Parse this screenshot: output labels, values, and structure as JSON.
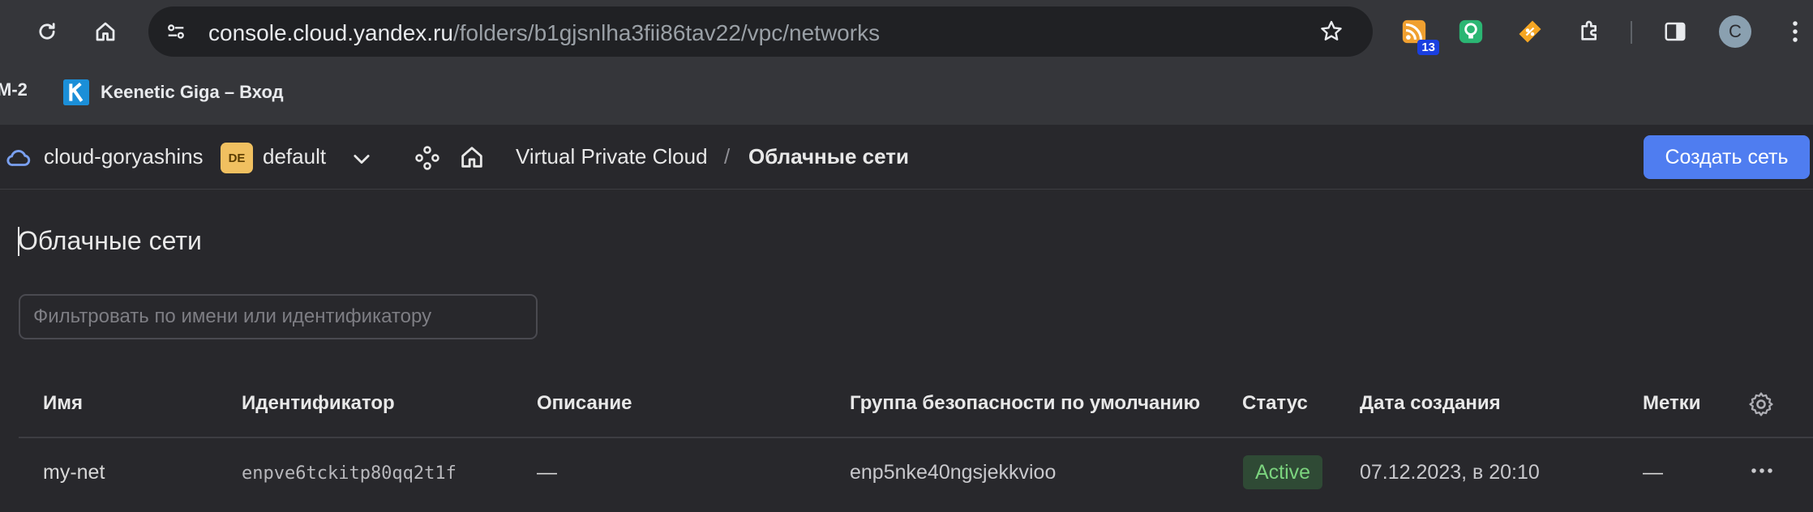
{
  "browser": {
    "url_host": "console.cloud.yandex.ru",
    "url_path": "/folders/b1gjsnlha3fii86tav22/vpc/networks",
    "extension_badge": "13",
    "profile_initial": "C"
  },
  "bookmarks": [
    {
      "label": "M-2"
    },
    {
      "label": "Keenetic Giga – Вход"
    }
  ],
  "header": {
    "cloud_name": "cloud-goryashins",
    "folder_badge": "DE",
    "folder_name": "default",
    "breadcrumb_service": "Virtual Private Cloud",
    "breadcrumb_separator": "/",
    "breadcrumb_current": "Облачные сети",
    "create_button": "Создать сеть"
  },
  "page": {
    "title": "Облачные сети",
    "filter_placeholder": "Фильтровать по имени или идентификатору"
  },
  "table": {
    "columns": [
      "Имя",
      "Идентификатор",
      "Описание",
      "Группа безопасности по умолчанию",
      "Статус",
      "Дата создания",
      "Метки"
    ],
    "rows": [
      {
        "name": "my-net",
        "id": "enpve6tckitp80qq2t1f",
        "description": "—",
        "security_group": "enp5nke40ngsjekkvioo",
        "status": "Active",
        "created": "07.12.2023, в 20:10",
        "labels": "—"
      }
    ]
  },
  "colors": {
    "accent": "#4f7df0",
    "status_active": "#7bd37e",
    "folder_badge": "#f0c060"
  }
}
